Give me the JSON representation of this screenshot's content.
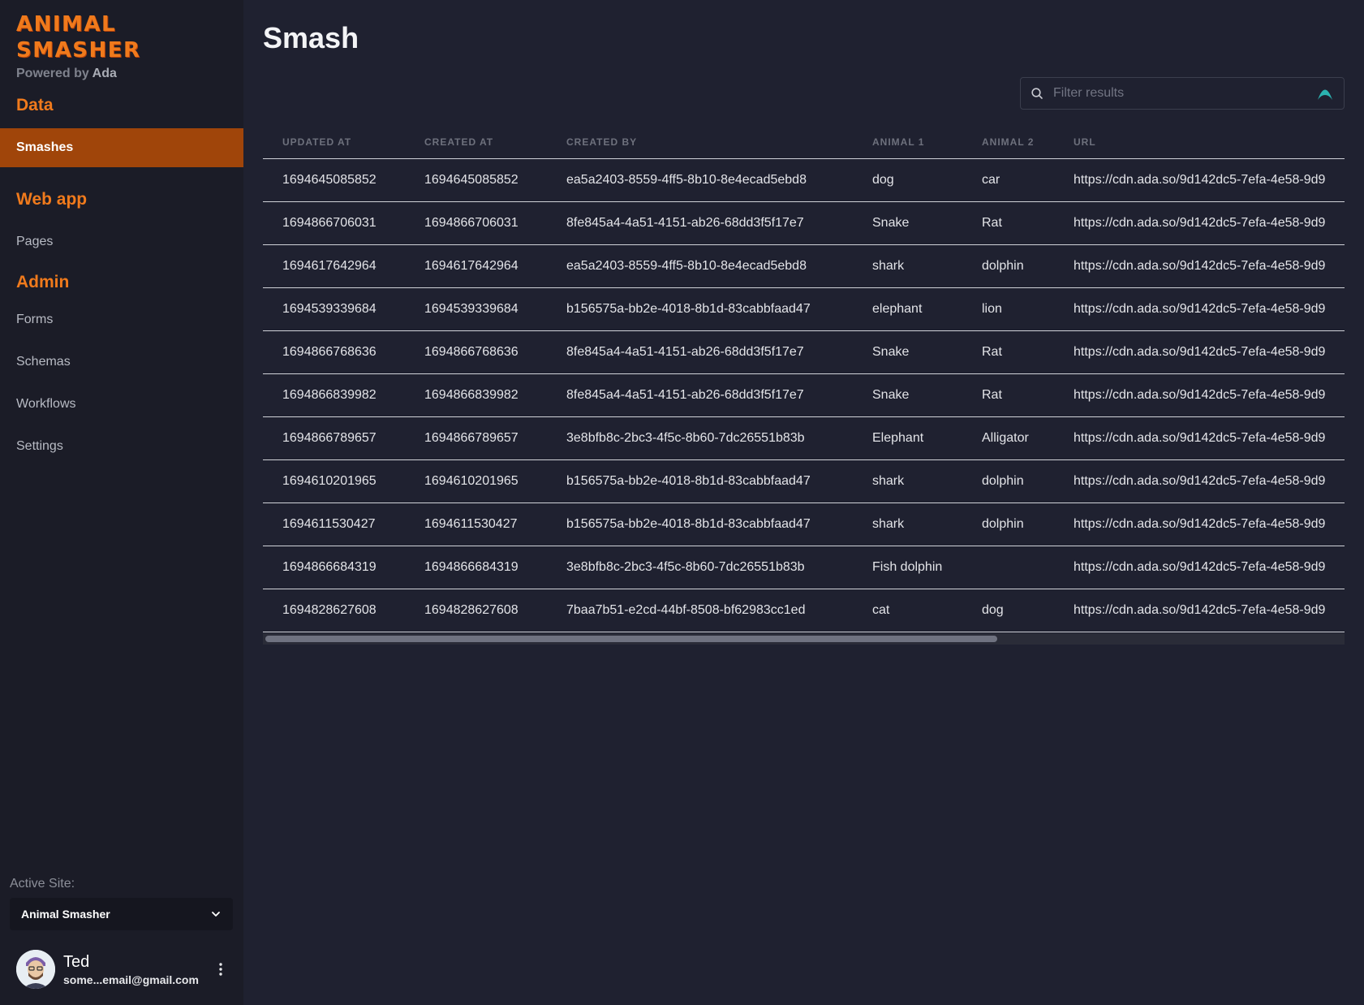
{
  "sidebar": {
    "logo": "ANIMAL SMASHER",
    "powered_prefix": "Powered by",
    "powered_name": "Ada",
    "sections": [
      {
        "title": "Data"
      },
      {
        "title": "Web app"
      },
      {
        "title": "Admin"
      }
    ],
    "data_items": [
      {
        "label": "Smashes"
      }
    ],
    "webapp_items": [
      {
        "label": "Pages"
      }
    ],
    "admin_items": [
      {
        "label": "Forms"
      },
      {
        "label": "Schemas"
      },
      {
        "label": "Workflows"
      },
      {
        "label": "Settings"
      }
    ],
    "active_site_label": "Active Site:",
    "active_site_value": "Animal Smasher",
    "user": {
      "name": "Ted",
      "email": "some...email@gmail.com"
    }
  },
  "main": {
    "title": "Smash",
    "search_placeholder": "Filter results",
    "columns": [
      "UPDATED AT",
      "CREATED AT",
      "CREATED BY",
      "ANIMAL 1",
      "ANIMAL 2",
      "URL"
    ],
    "rows": [
      [
        "1694645085852",
        "1694645085852",
        "ea5a2403-8559-4ff5-8b10-8e4ecad5ebd8",
        "dog",
        "car",
        "https://cdn.ada.so/9d142dc5-7efa-4e58-9d9"
      ],
      [
        "1694866706031",
        "1694866706031",
        "8fe845a4-4a51-4151-ab26-68dd3f5f17e7",
        "Snake",
        "Rat",
        "https://cdn.ada.so/9d142dc5-7efa-4e58-9d9"
      ],
      [
        "1694617642964",
        "1694617642964",
        "ea5a2403-8559-4ff5-8b10-8e4ecad5ebd8",
        "shark",
        "dolphin",
        "https://cdn.ada.so/9d142dc5-7efa-4e58-9d9"
      ],
      [
        "1694539339684",
        "1694539339684",
        "b156575a-bb2e-4018-8b1d-83cabbfaad47",
        "elephant",
        "lion",
        "https://cdn.ada.so/9d142dc5-7efa-4e58-9d9"
      ],
      [
        "1694866768636",
        "1694866768636",
        "8fe845a4-4a51-4151-ab26-68dd3f5f17e7",
        "Snake",
        "Rat",
        "https://cdn.ada.so/9d142dc5-7efa-4e58-9d9"
      ],
      [
        "1694866839982",
        "1694866839982",
        "8fe845a4-4a51-4151-ab26-68dd3f5f17e7",
        "Snake",
        "Rat",
        "https://cdn.ada.so/9d142dc5-7efa-4e58-9d9"
      ],
      [
        "1694866789657",
        "1694866789657",
        "3e8bfb8c-2bc3-4f5c-8b60-7dc26551b83b",
        "Elephant",
        "Alligator",
        "https://cdn.ada.so/9d142dc5-7efa-4e58-9d9"
      ],
      [
        "1694610201965",
        "1694610201965",
        "b156575a-bb2e-4018-8b1d-83cabbfaad47",
        "shark",
        "dolphin",
        "https://cdn.ada.so/9d142dc5-7efa-4e58-9d9"
      ],
      [
        "1694611530427",
        "1694611530427",
        "b156575a-bb2e-4018-8b1d-83cabbfaad47",
        "shark",
        "dolphin",
        "https://cdn.ada.so/9d142dc5-7efa-4e58-9d9"
      ],
      [
        "1694866684319",
        "1694866684319",
        "3e8bfb8c-2bc3-4f5c-8b60-7dc26551b83b",
        "Fish dolphin",
        "",
        "https://cdn.ada.so/9d142dc5-7efa-4e58-9d9"
      ],
      [
        "1694828627608",
        "1694828627608",
        "7baa7b51-e2cd-44bf-8508-bf62983cc1ed",
        "cat",
        "dog",
        "https://cdn.ada.so/9d142dc5-7efa-4e58-9d9"
      ]
    ],
    "horizontal_scroll_fraction": 0.68
  },
  "colors": {
    "accent": "#f07a1c",
    "active_nav_bg": "#a0450a",
    "sidebar_bg": "#1b1c27",
    "main_bg": "#1f2130"
  },
  "icons": [
    "search-icon",
    "ada-logo-icon",
    "chevron-down-icon",
    "more-vertical-icon",
    "avatar"
  ]
}
